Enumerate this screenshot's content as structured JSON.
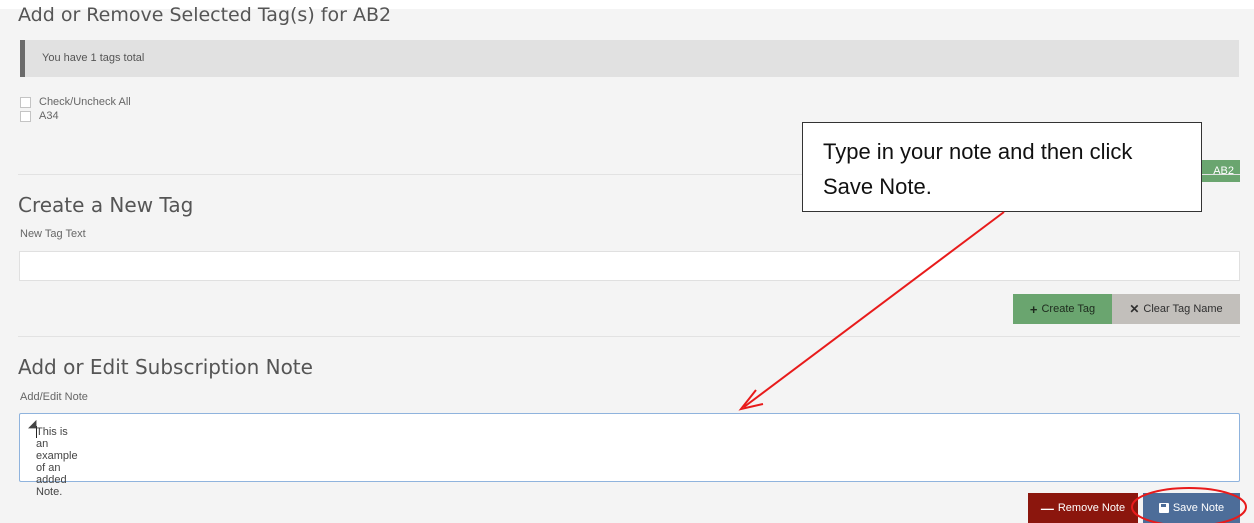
{
  "tags_section": {
    "title": "Add or Remove Selected Tag(s) for AB2",
    "info_text": "You have 1 tags total",
    "check_all_label": "Check/Uncheck All",
    "tags": [
      {
        "label": "A34",
        "checked": false
      }
    ],
    "apply_button_label": "AB2"
  },
  "create_tag_section": {
    "title": "Create a New Tag",
    "field_label": "New Tag Text",
    "field_value": "",
    "create_button_label": "Create Tag",
    "create_button_icon": "plus-icon",
    "clear_button_label": "Clear Tag Name",
    "clear_button_icon": "times-icon"
  },
  "note_section": {
    "title": "Add or Edit Subscription Note",
    "field_label": "Add/Edit Note",
    "note_value": "This is an example of an added Note.",
    "remove_button_label": "Remove Note",
    "remove_button_icon": "minus-icon",
    "save_button_label": "Save Note",
    "save_button_icon": "floppy-disk-icon"
  },
  "annotation": {
    "callout_text": "Type in your note and then click Save Note.",
    "arrow_color": "#e81b1b",
    "highlight_color": "#e81b1b"
  },
  "colors": {
    "success": "#6aa56f",
    "danger": "#8b160d",
    "primary": "#4d6d99",
    "neutral": "#c2bfbb"
  }
}
